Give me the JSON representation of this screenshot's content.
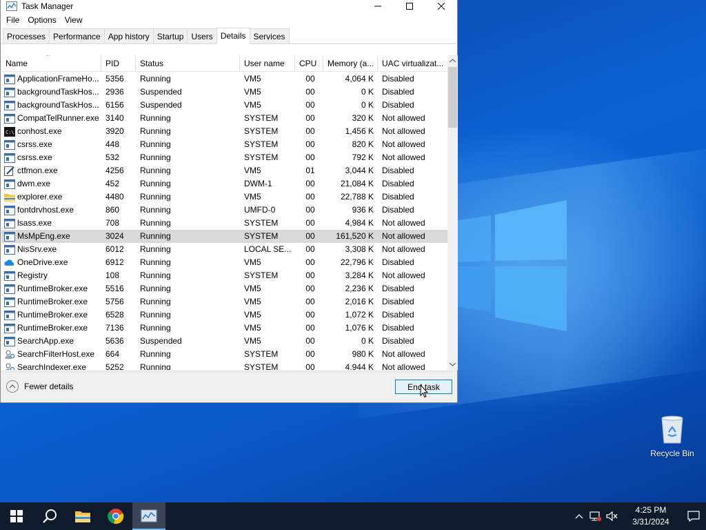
{
  "window": {
    "title": "Task Manager",
    "menu": [
      "File",
      "Options",
      "View"
    ],
    "tabs": [
      "Processes",
      "Performance",
      "App history",
      "Startup",
      "Users",
      "Details",
      "Services"
    ],
    "active_tab": "Details"
  },
  "table": {
    "sort_indicator": "^",
    "columns": [
      "Name",
      "PID",
      "Status",
      "User name",
      "CPU",
      "Memory (a...",
      "UAC virtualizat..."
    ],
    "selected_row": "MsMpEng.exe",
    "rows": [
      {
        "name": "ApplicationFrameHo...",
        "pid": "5356",
        "status": "Running",
        "user": "VM5",
        "cpu": "00",
        "mem": "4,064 K",
        "uac": "Disabled",
        "icon": "app-window-icon"
      },
      {
        "name": "backgroundTaskHos...",
        "pid": "2936",
        "status": "Suspended",
        "user": "VM5",
        "cpu": "00",
        "mem": "0 K",
        "uac": "Disabled",
        "icon": "app-window-icon"
      },
      {
        "name": "backgroundTaskHos...",
        "pid": "6156",
        "status": "Suspended",
        "user": "VM5",
        "cpu": "00",
        "mem": "0 K",
        "uac": "Disabled",
        "icon": "app-window-icon"
      },
      {
        "name": "CompatTelRunner.exe",
        "pid": "3140",
        "status": "Running",
        "user": "SYSTEM",
        "cpu": "00",
        "mem": "320 K",
        "uac": "Not allowed",
        "icon": "app-window-icon"
      },
      {
        "name": "conhost.exe",
        "pid": "3920",
        "status": "Running",
        "user": "SYSTEM",
        "cpu": "00",
        "mem": "1,456 K",
        "uac": "Not allowed",
        "icon": "console-icon"
      },
      {
        "name": "csrss.exe",
        "pid": "448",
        "status": "Running",
        "user": "SYSTEM",
        "cpu": "00",
        "mem": "820 K",
        "uac": "Not allowed",
        "icon": "app-window-icon"
      },
      {
        "name": "csrss.exe",
        "pid": "532",
        "status": "Running",
        "user": "SYSTEM",
        "cpu": "00",
        "mem": "792 K",
        "uac": "Not allowed",
        "icon": "app-window-icon"
      },
      {
        "name": "ctfmon.exe",
        "pid": "4256",
        "status": "Running",
        "user": "VM5",
        "cpu": "01",
        "mem": "3,044 K",
        "uac": "Disabled",
        "icon": "pen-icon"
      },
      {
        "name": "dwm.exe",
        "pid": "452",
        "status": "Running",
        "user": "DWM-1",
        "cpu": "00",
        "mem": "21,084 K",
        "uac": "Disabled",
        "icon": "app-window-icon"
      },
      {
        "name": "explorer.exe",
        "pid": "4480",
        "status": "Running",
        "user": "VM5",
        "cpu": "00",
        "mem": "22,788 K",
        "uac": "Disabled",
        "icon": "folder-icon"
      },
      {
        "name": "fontdrvhost.exe",
        "pid": "860",
        "status": "Running",
        "user": "UMFD-0",
        "cpu": "00",
        "mem": "936 K",
        "uac": "Disabled",
        "icon": "app-window-icon"
      },
      {
        "name": "lsass.exe",
        "pid": "708",
        "status": "Running",
        "user": "SYSTEM",
        "cpu": "00",
        "mem": "4,984 K",
        "uac": "Not allowed",
        "icon": "app-window-icon"
      },
      {
        "name": "MsMpEng.exe",
        "pid": "3024",
        "status": "Running",
        "user": "SYSTEM",
        "cpu": "00",
        "mem": "161,520 K",
        "uac": "Not allowed",
        "icon": "app-window-icon"
      },
      {
        "name": "NisSrv.exe",
        "pid": "6012",
        "status": "Running",
        "user": "LOCAL SE...",
        "cpu": "00",
        "mem": "3,308 K",
        "uac": "Not allowed",
        "icon": "app-window-icon"
      },
      {
        "name": "OneDrive.exe",
        "pid": "6912",
        "status": "Running",
        "user": "VM5",
        "cpu": "00",
        "mem": "22,796 K",
        "uac": "Disabled",
        "icon": "cloud-icon"
      },
      {
        "name": "Registry",
        "pid": "108",
        "status": "Running",
        "user": "SYSTEM",
        "cpu": "00",
        "mem": "3,284 K",
        "uac": "Not allowed",
        "icon": "app-window-icon"
      },
      {
        "name": "RuntimeBroker.exe",
        "pid": "5516",
        "status": "Running",
        "user": "VM5",
        "cpu": "00",
        "mem": "2,236 K",
        "uac": "Disabled",
        "icon": "app-window-icon"
      },
      {
        "name": "RuntimeBroker.exe",
        "pid": "5756",
        "status": "Running",
        "user": "VM5",
        "cpu": "00",
        "mem": "2,016 K",
        "uac": "Disabled",
        "icon": "app-window-icon"
      },
      {
        "name": "RuntimeBroker.exe",
        "pid": "6528",
        "status": "Running",
        "user": "VM5",
        "cpu": "00",
        "mem": "1,072 K",
        "uac": "Disabled",
        "icon": "app-window-icon"
      },
      {
        "name": "RuntimeBroker.exe",
        "pid": "7136",
        "status": "Running",
        "user": "VM5",
        "cpu": "00",
        "mem": "1,076 K",
        "uac": "Disabled",
        "icon": "app-window-icon"
      },
      {
        "name": "SearchApp.exe",
        "pid": "5636",
        "status": "Suspended",
        "user": "VM5",
        "cpu": "00",
        "mem": "0 K",
        "uac": "Disabled",
        "icon": "app-window-icon"
      },
      {
        "name": "SearchFilterHost.exe",
        "pid": "664",
        "status": "Running",
        "user": "SYSTEM",
        "cpu": "00",
        "mem": "980 K",
        "uac": "Not allowed",
        "icon": "search-person-icon"
      },
      {
        "name": "SearchIndexer.exe",
        "pid": "5252",
        "status": "Running",
        "user": "SYSTEM",
        "cpu": "00",
        "mem": "4,944 K",
        "uac": "Not allowed",
        "icon": "search-person-icon"
      }
    ]
  },
  "footer": {
    "fewer_details": "Fewer details",
    "end_task": "End task"
  },
  "desktop": {
    "recycle_bin": "Recycle Bin"
  },
  "taskbar": {
    "time": "4:25 PM",
    "date": "3/31/2024",
    "items": [
      "start-icon",
      "search-icon",
      "file-explorer-icon",
      "chrome-icon",
      "task-manager-icon"
    ]
  },
  "colors": {
    "accent": "#0078d7",
    "selected_row": "#d9d9d9",
    "taskbar": "#0f1a2b"
  }
}
